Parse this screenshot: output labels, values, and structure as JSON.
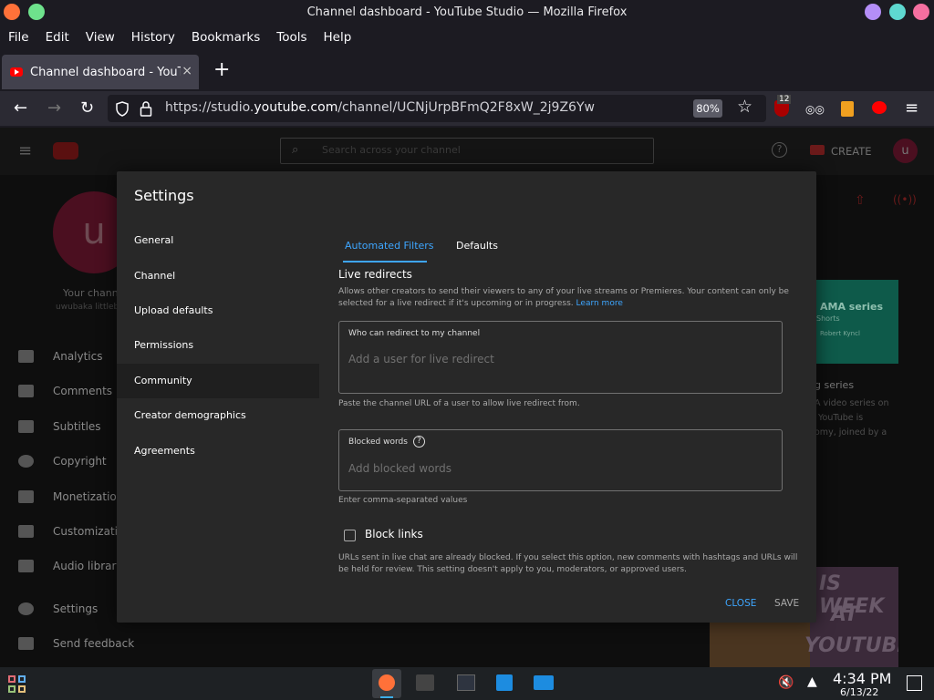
{
  "window": {
    "title": "Channel dashboard - YouTube Studio — Mozilla Firefox"
  },
  "menu": [
    "File",
    "Edit",
    "View",
    "History",
    "Bookmarks",
    "Tools",
    "Help"
  ],
  "tab": {
    "title": "Channel dashboard - YouTube Studio",
    "close": "×"
  },
  "navbar": {
    "url_prefix": "https://studio.",
    "url_domain": "youtube.com",
    "url_path": "/channel/UCNjUrpBFmQ2F8xW_2j9Z6Yw",
    "zoom": "80%",
    "ublock_count": "12"
  },
  "background": {
    "search_placeholder": "Search across your channel",
    "create_label": "CREATE",
    "avatar_letter": "u",
    "channel_label": "Your channel",
    "channel_name": "uwubaka littlebi",
    "nav": [
      "Analytics",
      "Comments",
      "Subtitles",
      "Copyright",
      "Monetization",
      "Customization",
      "Audio library",
      "Settings",
      "Send feedback"
    ],
    "card1_title": "AMA series",
    "card1_sub": "Shorts",
    "card1_person": "Robert Kyncl",
    "card_heading": "g series",
    "card_text": [
      "A video series on",
      "YouTube is",
      "omy, joined by a"
    ],
    "thumb_text": [
      "IS WEEK",
      "AT",
      "YOUTUBE"
    ]
  },
  "settings": {
    "title": "Settings",
    "sidebar": [
      "General",
      "Channel",
      "Upload defaults",
      "Permissions",
      "Community",
      "Creator demographics",
      "Agreements"
    ],
    "active_index": 4,
    "tabs": [
      "Automated Filters",
      "Defaults"
    ],
    "live_redirects": {
      "heading": "Live redirects",
      "desc1": "Allows other creators to send their viewers to any of your live streams or Premieres. Your content can only be",
      "desc2": "selected for a live redirect if it's upcoming or in progress.",
      "learn_more": "Learn more",
      "field_label": "Who can redirect to my channel",
      "field_placeholder": "Add a user for live redirect",
      "hint": "Paste the channel URL of a user to allow live redirect from."
    },
    "blocked_words": {
      "field_label": "Blocked words",
      "field_placeholder": "Add blocked words",
      "hint": "Enter comma-separated values"
    },
    "block_links": {
      "label": "Block links",
      "checked": false,
      "desc1": "URLs sent in live chat are already blocked. If you select this option, new comments with hashtags and URLs will",
      "desc2": "be held for review. This setting doesn't apply to you, moderators, or approved users."
    },
    "buttons": {
      "close": "CLOSE",
      "save": "SAVE"
    }
  },
  "taskbar": {
    "time": "4:34 PM",
    "date": "6/13/22"
  },
  "colors": {
    "accent_blue": "#3ea6ff",
    "youtube_red": "#ff0000",
    "avatar": "#8e1c3a"
  }
}
